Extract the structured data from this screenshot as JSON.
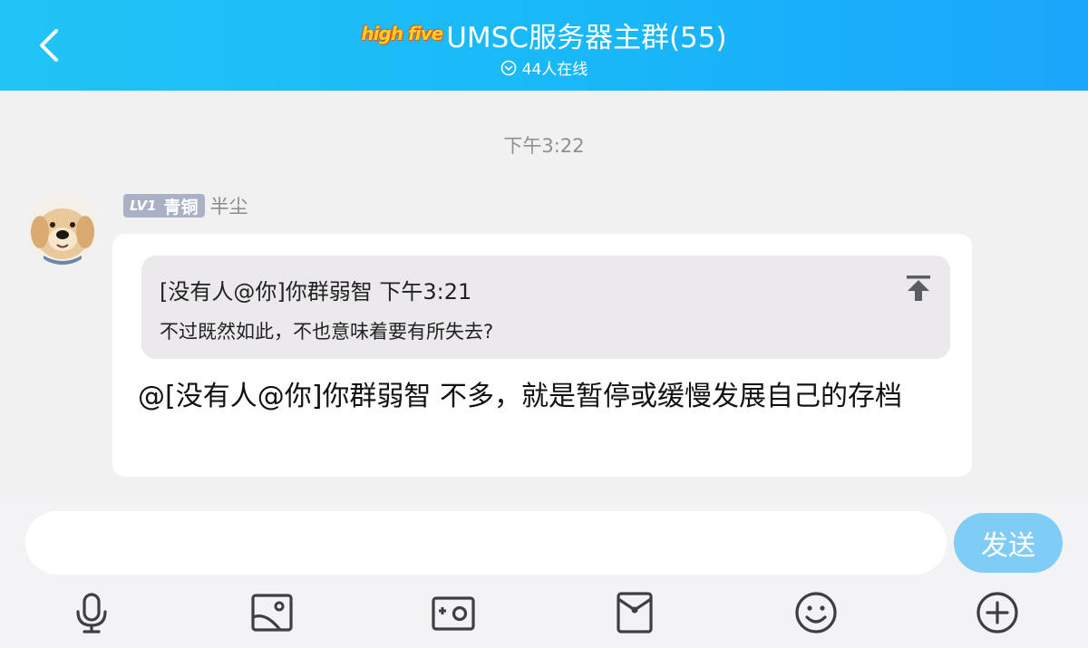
{
  "header": {
    "logo_text": "high five",
    "title": "UMSC服务器主群(55)",
    "online_status": "44人在线"
  },
  "chat": {
    "timestamp": "下午3:22",
    "message": {
      "level_badge": "LV1",
      "rank": "青铜",
      "sender": "半尘",
      "quote_header": "[没有人@你]你群弱智 下午3:21",
      "quote_text": "不过既然如此，不也意味着要有所失去?",
      "text": "@[没有人@你]你群弱智 不多，就是暂停或缓慢发展自己的存档"
    }
  },
  "input_bar": {
    "value": "",
    "send_label": "发送",
    "tools": [
      "microphone-icon",
      "image-icon",
      "camera-icon",
      "red-packet-icon",
      "emoji-icon",
      "plus-icon"
    ]
  },
  "colors": {
    "header_gradient_start": "#22c4f6",
    "header_gradient_end": "#1aa6fb",
    "send_button": "#7fccf7",
    "badge": "#aab0c6"
  }
}
